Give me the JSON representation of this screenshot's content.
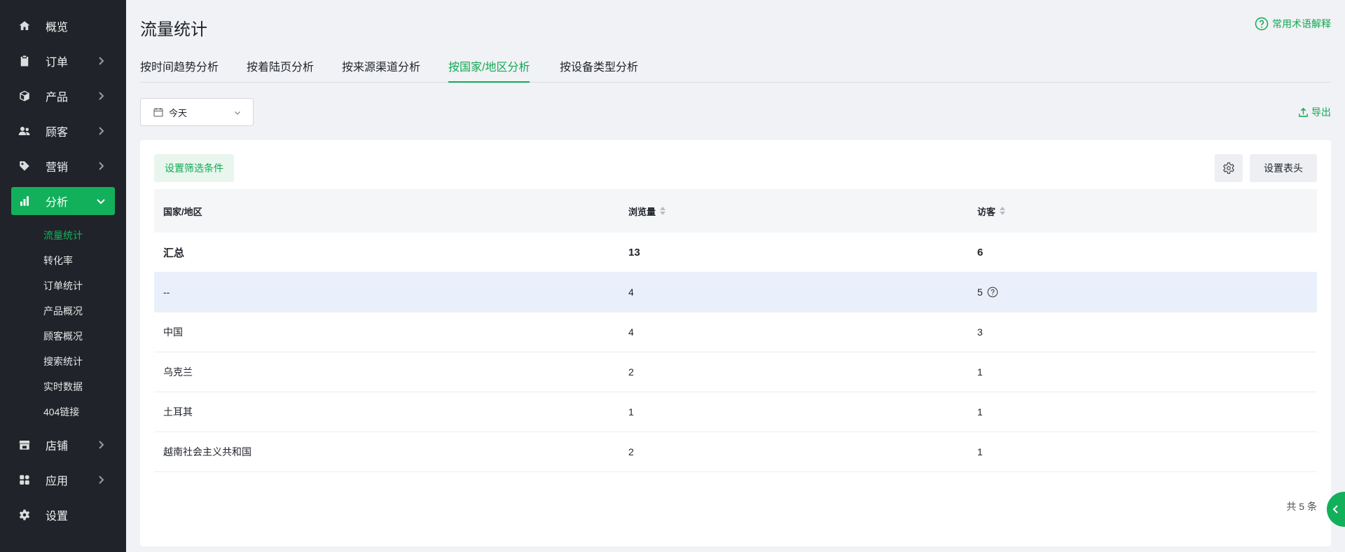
{
  "sidebar": {
    "items": [
      {
        "label": "概览",
        "icon": "home-icon"
      },
      {
        "label": "订单",
        "icon": "clipboard-icon"
      },
      {
        "label": "产品",
        "icon": "box-icon"
      },
      {
        "label": "顾客",
        "icon": "users-icon"
      },
      {
        "label": "营销",
        "icon": "tag-icon"
      },
      {
        "label": "分析",
        "icon": "bar-chart-icon"
      },
      {
        "label": "店铺",
        "icon": "store-icon"
      },
      {
        "label": "应用",
        "icon": "apps-icon"
      },
      {
        "label": "设置",
        "icon": "gear-icon"
      }
    ],
    "sub_items": [
      {
        "label": "流量统计"
      },
      {
        "label": "转化率"
      },
      {
        "label": "订单统计"
      },
      {
        "label": "产品概况"
      },
      {
        "label": "顾客概况"
      },
      {
        "label": "搜索统计"
      },
      {
        "label": "实时数据"
      },
      {
        "label": "404链接"
      }
    ]
  },
  "header": {
    "title": "流量统计",
    "help_label": "常用术语解释"
  },
  "tabs": [
    {
      "label": "按时间趋势分析"
    },
    {
      "label": "按着陆页分析"
    },
    {
      "label": "按来源渠道分析"
    },
    {
      "label": "按国家/地区分析"
    },
    {
      "label": "按设备类型分析"
    }
  ],
  "toolbar": {
    "date_value": "今天",
    "export_label": "导出"
  },
  "card": {
    "filter_label": "设置筛选条件",
    "header_settings_label": "设置表头"
  },
  "table": {
    "columns": [
      "国家/地区",
      "浏览量",
      "访客"
    ],
    "total": {
      "name": "汇总",
      "views": "13",
      "visitors": "6"
    },
    "rows": [
      {
        "name": "--",
        "views": "4",
        "visitors": "5"
      },
      {
        "name": "中国",
        "views": "4",
        "visitors": "3"
      },
      {
        "name": "乌克兰",
        "views": "2",
        "visitors": "1"
      },
      {
        "name": "土耳其",
        "views": "1",
        "visitors": "1"
      },
      {
        "name": "越南社会主义共和国",
        "views": "2",
        "visitors": "1"
      }
    ],
    "footer_count": "共 5 条"
  },
  "colors": {
    "accent": "#12b05a",
    "sidebar_bg": "#20232a",
    "highlight_row": "#e9f0fb"
  }
}
